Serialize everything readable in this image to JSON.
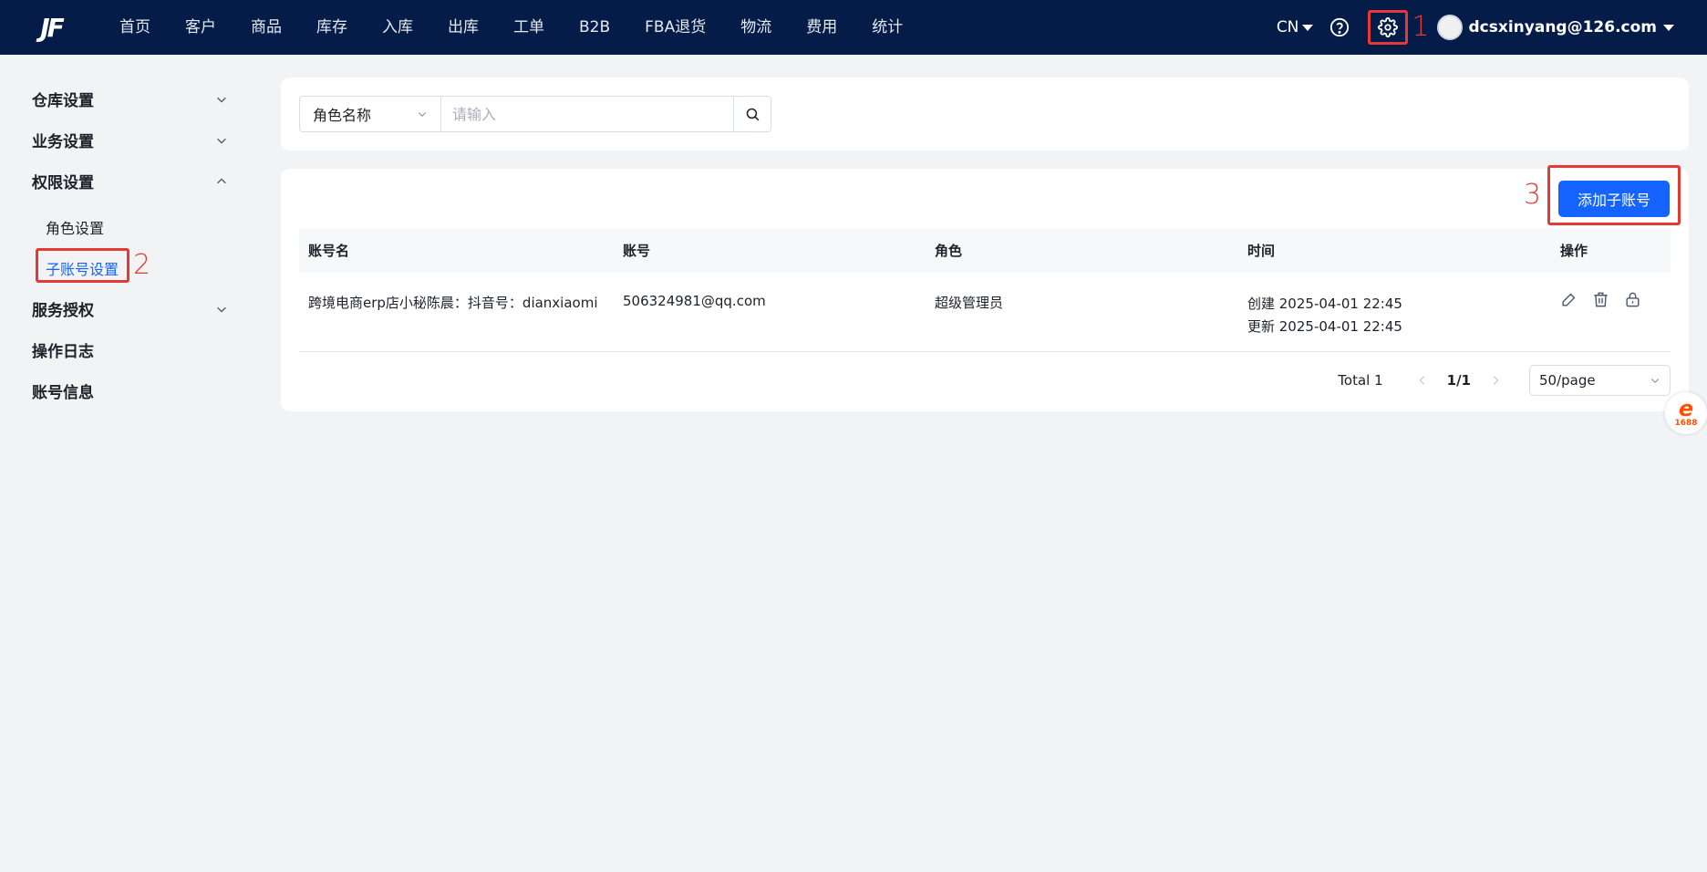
{
  "header": {
    "logo": "JF",
    "nav": [
      "首页",
      "客户",
      "商品",
      "库存",
      "入库",
      "出库",
      "工单",
      "B2B",
      "FBA退货",
      "物流",
      "费用",
      "统计"
    ],
    "lang": "CN",
    "user_email": "dcsxinyang@126.com",
    "icons": {
      "help": "help-circle-icon",
      "settings": "gear-icon"
    }
  },
  "annotations": {
    "one": "1",
    "two": "2",
    "three": "3",
    "color": "#e53935"
  },
  "sidebar": {
    "groups": [
      {
        "label": "仓库设置",
        "expanded": false
      },
      {
        "label": "业务设置",
        "expanded": false
      },
      {
        "label": "权限设置",
        "expanded": true
      },
      {
        "label": "服务授权",
        "expanded": false
      },
      {
        "label": "操作日志"
      },
      {
        "label": "账号信息"
      }
    ],
    "sub_items": [
      {
        "label": "角色设置",
        "active": false
      },
      {
        "label": "子账号设置",
        "active": true
      }
    ]
  },
  "search": {
    "field_label": "角色名称",
    "placeholder": "请输入",
    "value": ""
  },
  "toolbar": {
    "add_label": "添加子账号"
  },
  "table": {
    "columns": [
      "账号名",
      "账号",
      "角色",
      "时间",
      "操作"
    ],
    "rows": [
      {
        "name": "跨境电商erp店小秘陈晨：抖音号：dianxiaomi",
        "account": "506324981@qq.com",
        "role": "超级管理员",
        "created": "创建 2025-04-01 22:45",
        "updated": "更新 2025-04-01 22:45"
      }
    ]
  },
  "pagination": {
    "total": "Total 1",
    "page": "1/1",
    "page_size": "50/page"
  },
  "floating_badge": {
    "mark": "e",
    "number": "1688",
    "color": "#ff5000"
  },
  "colors": {
    "nav_bg": "#041c47",
    "primary": "#1664ff",
    "page_bg": "#f2f3f5"
  }
}
